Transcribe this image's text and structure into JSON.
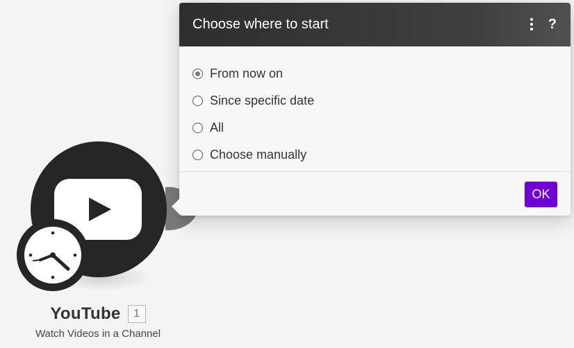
{
  "dialog": {
    "title": "Choose where to start",
    "icons": [
      "kebab-menu-icon",
      "help-icon"
    ],
    "help_glyph": "?",
    "options": [
      {
        "label": "From now on",
        "checked": true
      },
      {
        "label": "Since specific date",
        "checked": false
      },
      {
        "label": "All",
        "checked": false
      },
      {
        "label": "Choose manually",
        "checked": false
      }
    ],
    "ok_label": "OK",
    "ok_color": "#6f00d6"
  },
  "module": {
    "name": "YouTube",
    "id": "1",
    "subtitle": "Watch Videos in a Channel",
    "icon": "youtube-icon",
    "badge_icon": "clock-icon"
  }
}
